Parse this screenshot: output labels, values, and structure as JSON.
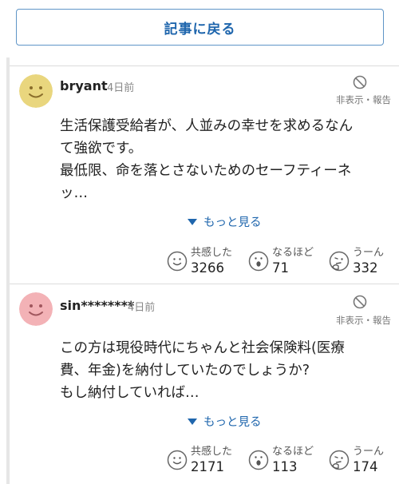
{
  "header": {
    "back_label": "記事に戻る"
  },
  "comments": [
    {
      "username": "bryant",
      "time": "4日前",
      "avatar_color": "#e9d67e",
      "hide_label": "非表示・報告",
      "lines": [
        "生活保護受給者が、人並みの幸せを求めるなん",
        "て強欲です。",
        "最低限、命を落とさないためのセーフティーネ",
        "ッ…"
      ],
      "more_label": "もっと見る",
      "reactions": {
        "empathy": {
          "label": "共感した",
          "count": "3266"
        },
        "agree": {
          "label": "なるほど",
          "count": "71"
        },
        "hmm": {
          "label": "うーん",
          "count": "332"
        }
      }
    },
    {
      "username": "sin********",
      "time": "4日前",
      "avatar_color": "#f3b2b6",
      "hide_label": "非表示・報告",
      "lines": [
        "この方は現役時代にちゃんと社会保険料(医療",
        "費、年金)を納付していたのでしょうか?",
        "もし納付していれば…"
      ],
      "more_label": "もっと見る",
      "reactions": {
        "empathy": {
          "label": "共感した",
          "count": "2171"
        },
        "agree": {
          "label": "なるほど",
          "count": "113"
        },
        "hmm": {
          "label": "うーん",
          "count": "174"
        }
      }
    }
  ]
}
